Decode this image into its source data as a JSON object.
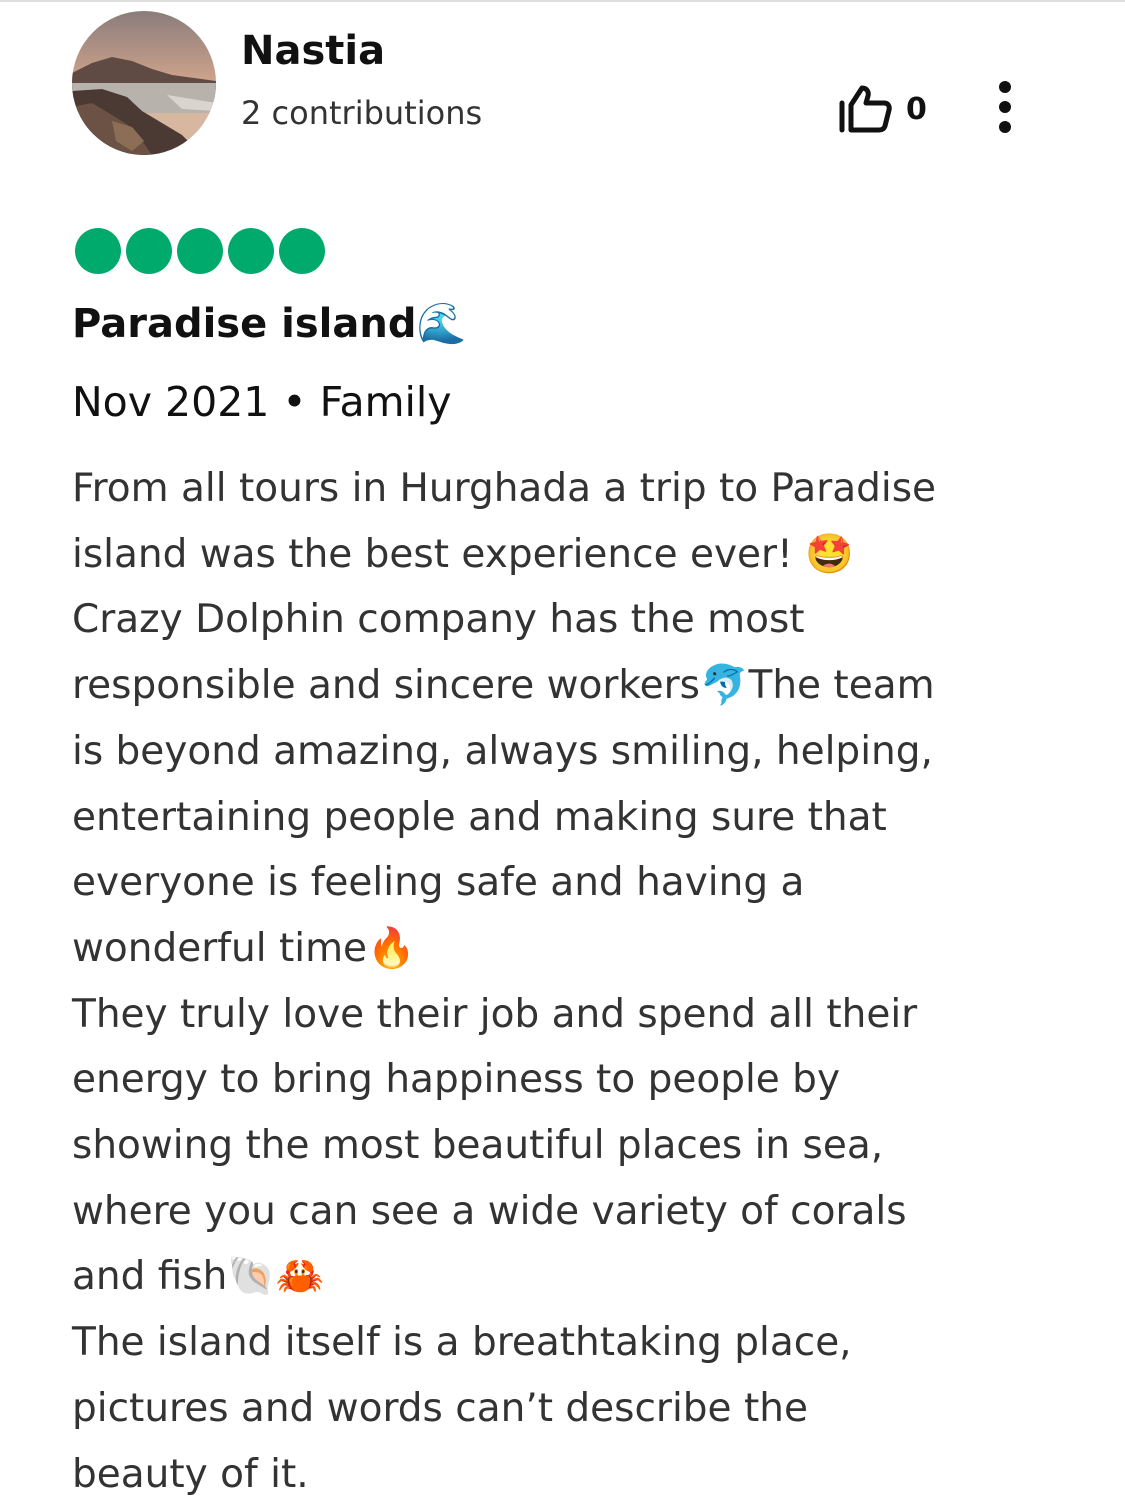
{
  "reviewer": {
    "name": "Nastia",
    "contributions": "2 contributions",
    "avatar_icon": "landscape-photo-avatar"
  },
  "actions": {
    "helpful_icon": "thumbs-up-icon",
    "helpful_count": "0",
    "more_icon": "vertical-ellipsis-icon"
  },
  "rating": {
    "value": 5,
    "max": 5,
    "color": "#00aa6c"
  },
  "review": {
    "title": "Paradise island🌊",
    "meta": "Nov 2021 • Family",
    "body_lines": [
      "From all tours in Hurghada a trip to Paradise",
      "island was the best experience ever! 🤩",
      "Crazy Dolphin company has the most",
      "responsible and sincere workers🐬The team",
      "is beyond amazing, always smiling, helping,",
      "entertaining people and making sure that",
      "everyone is feeling safe and having a",
      "wonderful time🔥",
      "They truly love their job and spend all their",
      "energy to bring happiness to people by",
      "showing the most beautiful places in sea,",
      "where you can see a wide variety of corals",
      "and fish🐚🦀",
      "The island itself is a breathtaking place,",
      "pictures and words can’t describe the",
      "beauty of it."
    ]
  }
}
